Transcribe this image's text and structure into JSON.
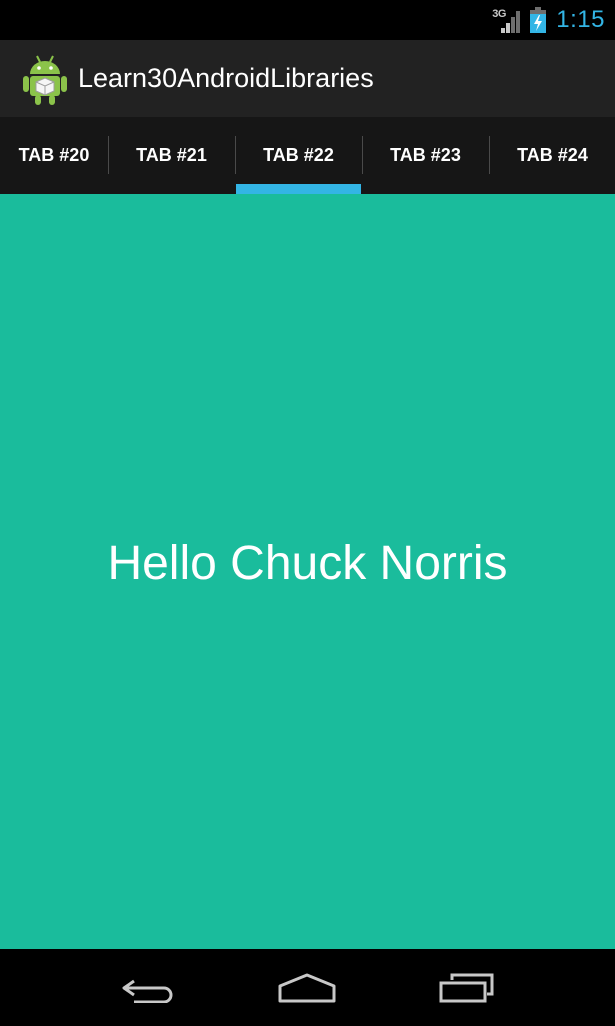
{
  "status_bar": {
    "network_type": "3G",
    "signal_icon": "signal-bars-icon",
    "battery_icon": "battery-charging-icon",
    "time": "1:15"
  },
  "action_bar": {
    "app_icon": "android-robot-icon",
    "title": "Learn30AndroidLibraries"
  },
  "tabs": [
    {
      "label": "TAB #20"
    },
    {
      "label": "TAB #21"
    },
    {
      "label": "TAB #22",
      "selected": true
    },
    {
      "label": "TAB #23"
    },
    {
      "label": "TAB #24"
    }
  ],
  "content": {
    "message": "Hello Chuck Norris",
    "background_color": "#1abc9c"
  },
  "nav_bar": {
    "back_icon": "back-icon",
    "home_icon": "home-icon",
    "recents_icon": "recent-apps-icon"
  },
  "colors": {
    "accent": "#33b5e5",
    "action_bar": "#222222",
    "tab_strip": "#161616"
  }
}
